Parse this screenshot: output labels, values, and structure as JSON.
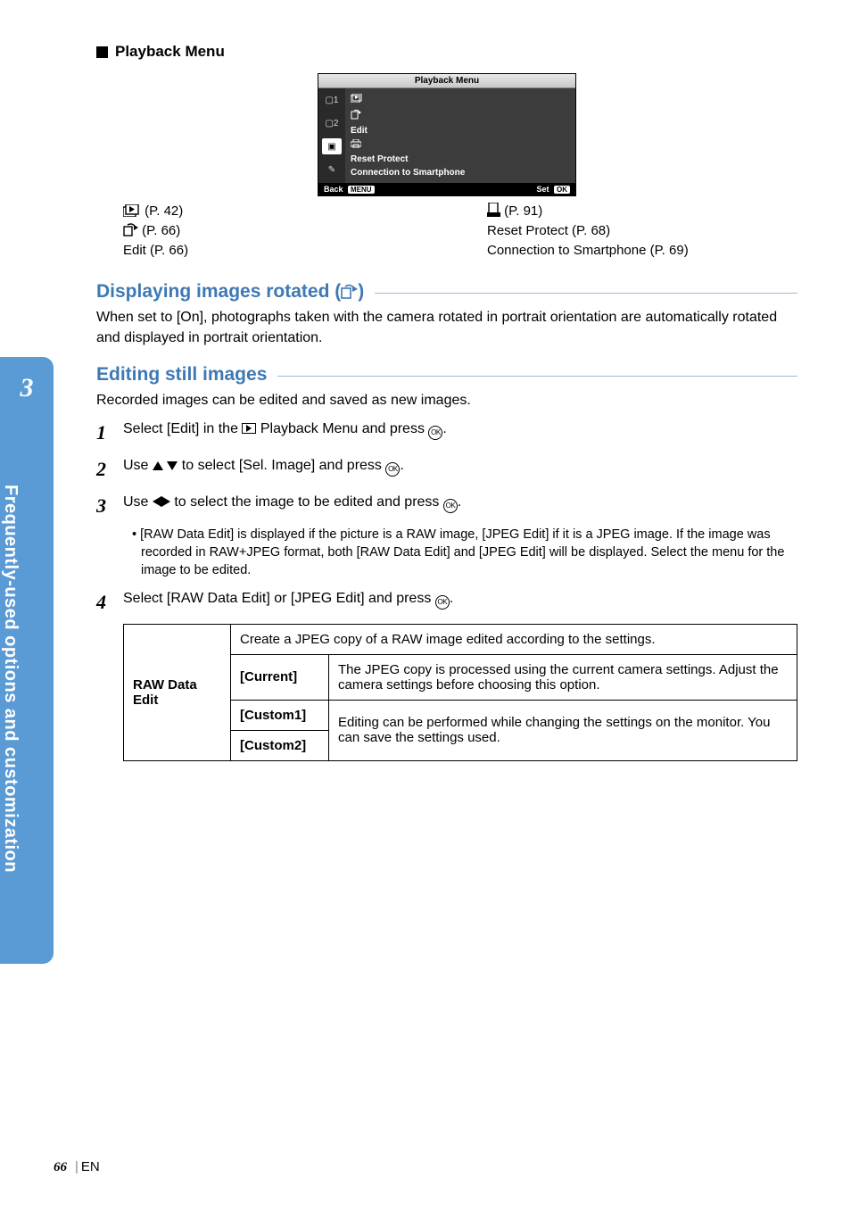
{
  "side": {
    "chapter": "3",
    "label": "Frequently-used options and customization"
  },
  "section_title": "Playback Menu",
  "menu": {
    "title": "Playback Menu",
    "items": {
      "slideshow_icon": "▶",
      "rotate_icon": "⟲",
      "edit": "Edit",
      "print_icon": "⎙",
      "reset": "Reset Protect",
      "smartphone": "Connection to Smartphone"
    },
    "left_icons": {
      "c1": "▢1",
      "c2": "▢2",
      "play": "▣",
      "wrench": "✎"
    },
    "footer": {
      "back": "Back",
      "back_btn": "MENU",
      "set": "Set",
      "set_btn": "OK"
    }
  },
  "refs": {
    "left": {
      "slideshow": "(P. 42)",
      "rotate": "(P. 66)",
      "edit": "Edit (P. 66)"
    },
    "right": {
      "print": "(P. 91)",
      "reset": "Reset Protect (P. 68)",
      "smartphone": "Connection to Smartphone (P. 69)"
    }
  },
  "h1": {
    "prefix": "Displaying images rotated (",
    "suffix": ")"
  },
  "p1": "When set to [On], photographs taken with the camera rotated in portrait orientation are automatically rotated and displayed in portrait orientation.",
  "h2": "Editing still images",
  "p2": "Recorded images can be edited and saved as new images.",
  "steps": {
    "s1a": "Select [Edit] in the ",
    "s1b": " Playback Menu and press ",
    "s1c": ".",
    "s2a": "Use ",
    "s2b": " to select [Sel. Image] and press ",
    "s2c": ".",
    "s3a": "Use ",
    "s3b": " to select the image to be edited and press ",
    "s3c": ".",
    "s3_bullet": "[RAW Data Edit] is displayed if the picture is a RAW image, [JPEG Edit] if it is a JPEG image. If the image was recorded in RAW+JPEG format, both [RAW Data Edit] and [JPEG Edit] will be displayed. Select the menu for the image to be edited.",
    "s4a": "Select [RAW Data Edit] or [JPEG Edit] and press ",
    "s4b": "."
  },
  "table": {
    "rowhead": "RAW Data Edit",
    "desc": "Create a JPEG copy of a RAW image edited according to the settings.",
    "current": "[Current]",
    "current_desc": "The JPEG copy is processed using the current camera settings. Adjust the camera settings before choosing this option.",
    "custom1": "[Custom1]",
    "custom2": "[Custom2]",
    "custom_desc": "Editing can be performed while changing the settings on the monitor. You can save the settings used."
  },
  "footer": {
    "page": "66",
    "lang": "EN"
  }
}
